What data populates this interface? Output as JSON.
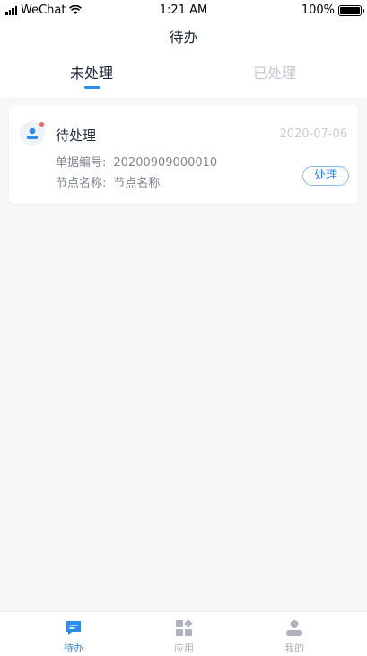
{
  "status_bar": {
    "carrier": "WeChat",
    "time": "1:21 AM",
    "battery": "100%"
  },
  "nav": {
    "title": "待办"
  },
  "tabs": [
    {
      "label": "未处理"
    },
    {
      "label": "已处理"
    }
  ],
  "todo_list": [
    {
      "title": "待处理",
      "date": "2020-07-06",
      "order_no_label": "单据编号:",
      "order_no": "20200909000010",
      "node_label": "节点名称:",
      "node_name": "节点名称",
      "action_label": "处理"
    }
  ],
  "bottom_nav": [
    {
      "label": "待办"
    },
    {
      "label": "应用"
    },
    {
      "label": "我的"
    }
  ],
  "colors": {
    "accent": "#2d8cf0",
    "inactive": "#aeb3bc",
    "background": "#f6f7f9",
    "badge": "#f5655a"
  }
}
